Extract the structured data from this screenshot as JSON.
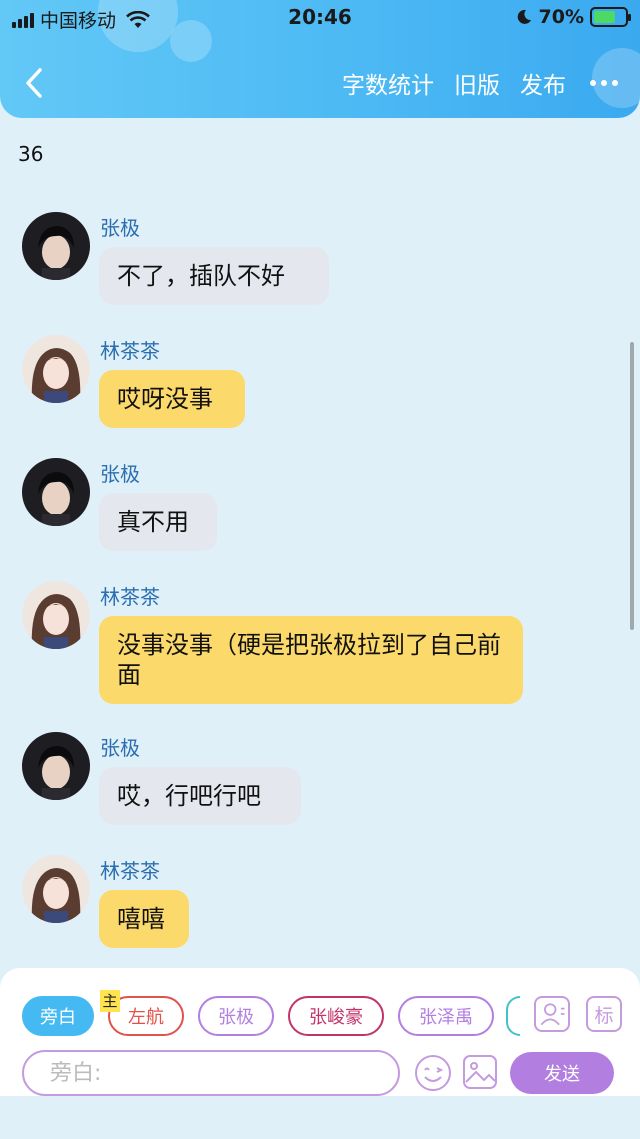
{
  "status_bar": {
    "carrier": "中国移动",
    "time": "20:46",
    "battery": "70%",
    "battery_level": 0.7
  },
  "nav": {
    "back_icon": "chevron-left-icon",
    "actions": [
      "字数统计",
      "旧版",
      "发布"
    ],
    "more_icon": "more-dots-icon"
  },
  "word_count": "36",
  "messages": [
    {
      "sender": "张极",
      "text": "不了，插队不好",
      "style": "grey"
    },
    {
      "sender": "林茶茶",
      "text": "哎呀没事",
      "style": "yellow"
    },
    {
      "sender": "张极",
      "text": "真不用",
      "style": "grey"
    },
    {
      "sender": "林茶茶",
      "text": "没事没事（硬是把张极拉到了自己前面",
      "style": "yellow"
    },
    {
      "sender": "张极",
      "text": "哎，行吧行吧",
      "style": "grey"
    },
    {
      "sender": "林茶茶",
      "text": "嘻嘻",
      "style": "yellow"
    }
  ],
  "composer": {
    "host_tag": "主",
    "characters": [
      {
        "label": "旁白",
        "color": "#45b9f2",
        "active": true
      },
      {
        "label": "左航",
        "color": "#e0524a",
        "active": false
      },
      {
        "label": "张极",
        "color": "#b27fe0",
        "active": false
      },
      {
        "label": "张峻豪",
        "color": "#c2336a",
        "active": false
      },
      {
        "label": "张泽禹",
        "color": "#b27fe0",
        "active": false
      }
    ],
    "tool_icons": [
      "person-card-icon",
      "label-icon"
    ],
    "tool_label": "标",
    "input_placeholder": "旁白:",
    "send_label": "发送"
  }
}
